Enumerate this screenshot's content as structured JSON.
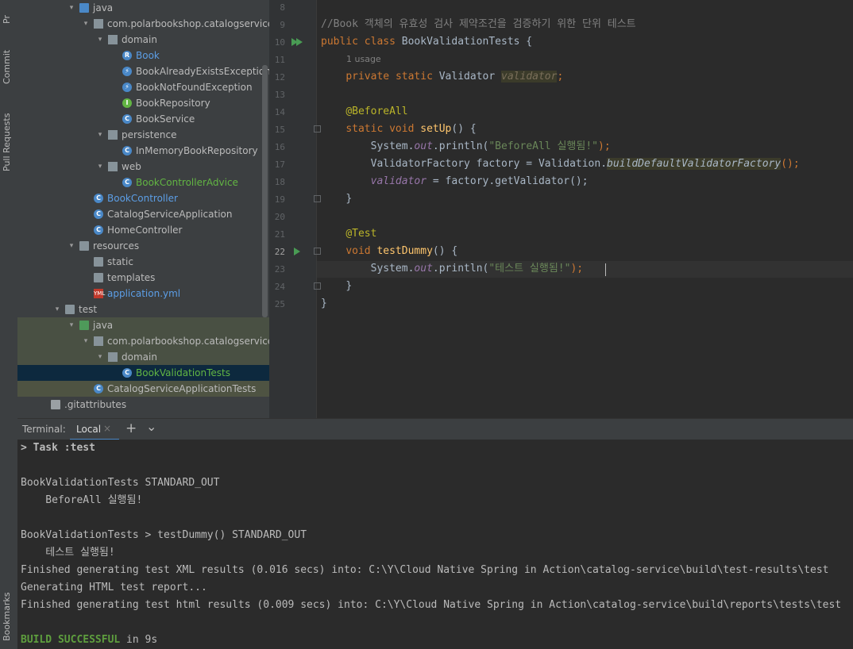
{
  "strip": {
    "project": "Pr",
    "commit": "Commit",
    "pull_requests": "Pull Requests",
    "bookmarks": "Bookmarks"
  },
  "tree": {
    "items": [
      {
        "label": "java",
        "type": "folder",
        "color": "blue"
      },
      {
        "label": "com.polarbookshop.catalogservice",
        "type": "package"
      },
      {
        "label": "domain",
        "type": "package"
      },
      {
        "label": "Book",
        "type": "record"
      },
      {
        "label": "BookAlreadyExistsException",
        "type": "exception"
      },
      {
        "label": "BookNotFoundException",
        "type": "exception"
      },
      {
        "label": "BookRepository",
        "type": "interface"
      },
      {
        "label": "BookService",
        "type": "class"
      },
      {
        "label": "persistence",
        "type": "package"
      },
      {
        "label": "InMemoryBookRepository",
        "type": "class"
      },
      {
        "label": "web",
        "type": "package"
      },
      {
        "label": "BookControllerAdvice",
        "type": "class"
      },
      {
        "label": "BookController",
        "type": "class"
      },
      {
        "label": "CatalogServiceApplication",
        "type": "class"
      },
      {
        "label": "HomeController",
        "type": "class"
      },
      {
        "label": "resources",
        "type": "folder"
      },
      {
        "label": "static",
        "type": "folder"
      },
      {
        "label": "templates",
        "type": "folder"
      },
      {
        "label": "application.yml",
        "type": "yml"
      },
      {
        "label": "test",
        "type": "folder"
      },
      {
        "label": "java",
        "type": "folder",
        "color": "green"
      },
      {
        "label": "com.polarbookshop.catalogservice",
        "type": "package"
      },
      {
        "label": "domain",
        "type": "package"
      },
      {
        "label": "BookValidationTests",
        "type": "class"
      },
      {
        "label": "CatalogServiceApplicationTests",
        "type": "class"
      },
      {
        "label": ".gitattributes",
        "type": "file"
      }
    ]
  },
  "editor": {
    "line_numbers": [
      "8",
      "9",
      "10",
      "11",
      "12",
      "13",
      "14",
      "15",
      "16",
      "17",
      "18",
      "19",
      "20",
      "21",
      "22",
      "23",
      "24",
      "25"
    ],
    "comment": "//Book 객체의 유효성 검사 제약조건을 검증하기 위한 단위 테스트",
    "usage_hint": "1 usage",
    "kw_public": "public",
    "kw_class": "class",
    "class_name": "BookValidationTests",
    "brace_open": " {",
    "kw_private": "private",
    "kw_static": "static",
    "type_validator": "Validator",
    "field_validator": "validator",
    "semicolon": ";",
    "ann_beforeall": "@BeforeAll",
    "kw_void": "void",
    "method_setup": "setUp",
    "parens_brace": "() {",
    "sysout_prefix": "System.",
    "out": "out",
    "println_open": ".println(",
    "str_beforeall": "\"BeforeAll 실행됨!\"",
    "close_paren_semi": ");",
    "factory_decl": "ValidatorFactory factory = Validation.",
    "build_factory": "buildDefaultValidatorFactory",
    "call_end": "();",
    "assign_rest": " = factory.getValidator();",
    "close_brace": "}",
    "ann_test": "@Test",
    "method_testdummy": "testDummy",
    "str_test": "\"테스트 실행됨!\""
  },
  "terminal": {
    "label": "Terminal:",
    "tab": "Local",
    "add": "+",
    "more": "⌄",
    "lines": [
      "> Task :test",
      "",
      "BookValidationTests STANDARD_OUT",
      "    BeforeAll 실행됨!",
      "",
      "BookValidationTests > testDummy() STANDARD_OUT",
      "    테스트 실행됨!",
      "Finished generating test XML results (0.016 secs) into: C:\\Y\\Cloud Native Spring in Action\\catalog-service\\build\\test-results\\test",
      "Generating HTML test report...",
      "Finished generating test html results (0.009 secs) into: C:\\Y\\Cloud Native Spring in Action\\catalog-service\\build\\reports\\tests\\test",
      ""
    ],
    "build_status": "BUILD SUCCESSFUL",
    "build_time": " in 9s"
  },
  "colors": {
    "accent_green": "#5e9e3e",
    "selection": "#0d293e",
    "keyword": "#cc7832"
  }
}
